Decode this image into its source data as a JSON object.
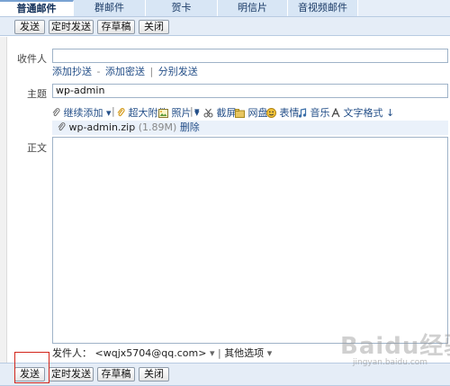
{
  "tabs": [
    "普通邮件",
    "群邮件",
    "贺卡",
    "明信片",
    "音视频邮件"
  ],
  "toolbar": {
    "send": "发送",
    "schedule": "定时发送",
    "draft": "存草稿",
    "close": "关闭"
  },
  "form": {
    "to_label": "收件人",
    "to_value": "",
    "links": {
      "cc": "添加抄送",
      "bcc": "添加密送",
      "separate": "分别发送",
      "dash": "-",
      "bar": "|"
    },
    "subject_label": "主题",
    "subject_value": "wp-admin",
    "body_label": "正文"
  },
  "attach_tools": {
    "continue_add": "继续添加",
    "large_attach": "超大附件",
    "photo": "照片",
    "screenshot": "截屏",
    "netdisk": "网盘",
    "emoji": "表情",
    "music": "音乐",
    "text_format": "文字格式",
    "caret": "▾",
    "arrow": "↓",
    "divider": "|"
  },
  "attachment": {
    "name": "wp-admin.zip",
    "size": "(1.89M)",
    "delete": "删除"
  },
  "sender": {
    "label": "发件人：",
    "address": "<wqjx5704@qq.com>",
    "caret": "▾",
    "more": "其他选项",
    "more_caret": "▾",
    "divider": "|"
  },
  "watermark": {
    "logo": "Baidu经验",
    "url": "jingyan.baidu.com"
  },
  "colors": {
    "tab_bg": "#d8e6f5",
    "toolbar_bg": "#e5edf7",
    "link": "#244f88",
    "highlight_box": "#d2251a"
  }
}
